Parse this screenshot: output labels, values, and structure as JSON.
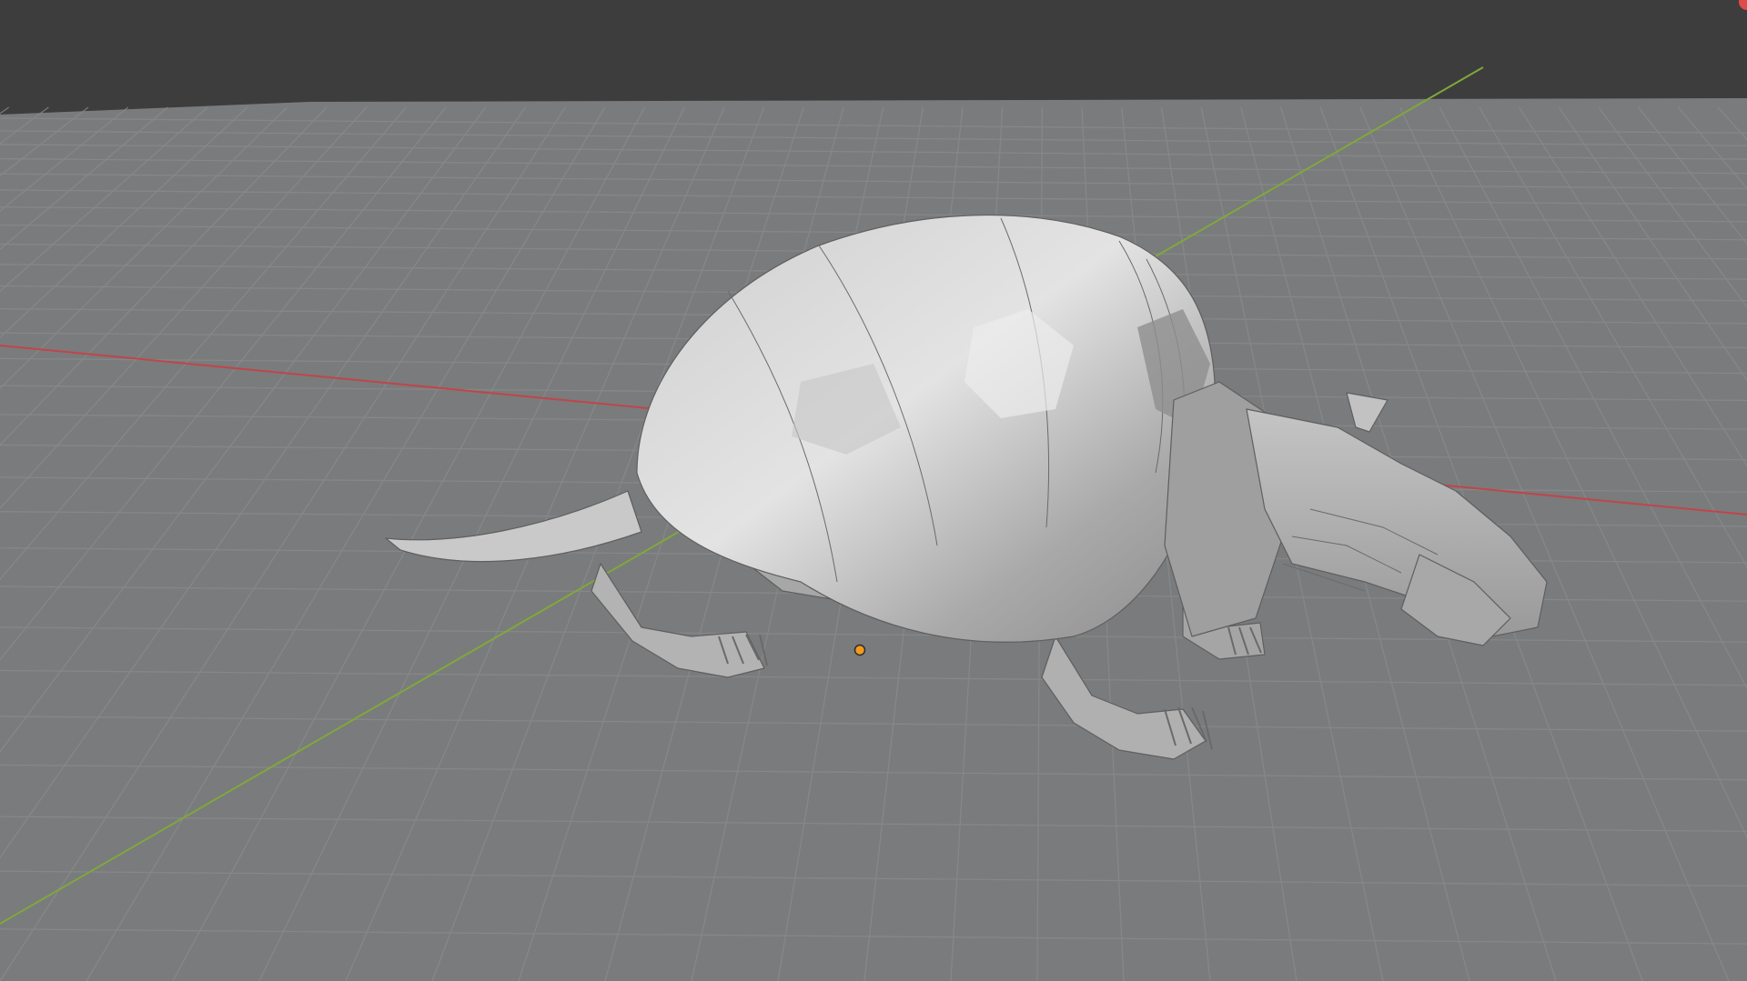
{
  "app": "3D Viewport",
  "viewport": {
    "background_color": "#3d3d3d",
    "floor_color": "#7a7b7d",
    "grid_color": "#8a8b8d",
    "x_axis_color": "#c0454a",
    "y_axis_color": "#7fa83a",
    "origin_color": "#f29a1e",
    "model_color": "#b9b9b9",
    "model": "low-poly-armadillo-mesh",
    "corner_gizmo_color": "#e04b4b"
  }
}
